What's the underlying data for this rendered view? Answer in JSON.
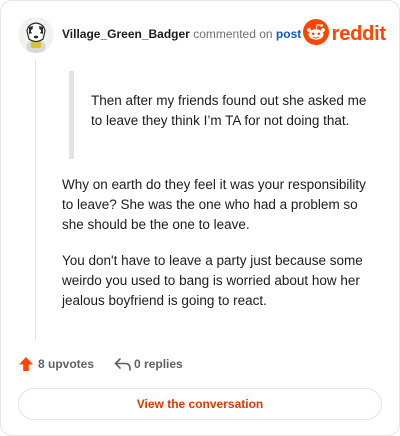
{
  "comment": {
    "author": "Village_Green_Badger",
    "action_text": "commented on",
    "post_link": "post",
    "brand": "reddit",
    "quote": "Then after my friends found out she asked me to leave they think I’m TA for not doing that.",
    "paragraphs": [
      "Why on earth do they feel it was your responsibility to leave? She was the one who had a problem so she should be the one to leave.",
      "You don't have to leave a party just because some weirdo you used to bang is worried about how her jealous boyfriend is going to react."
    ],
    "upvotes_label": "8 upvotes",
    "replies_label": "0 replies",
    "view_conversation_label": "View the conversation"
  },
  "colors": {
    "brand_orange": "#ff4500",
    "link_blue": "#0a58c9",
    "upvote_arrow": "#ff4500",
    "button_text": "#d93a00"
  },
  "icons": {
    "avatar": "avatar",
    "reddit_logo": "reddit-snoo-icon",
    "upvote": "upvote-arrow-icon",
    "reply": "reply-arrow-icon"
  }
}
